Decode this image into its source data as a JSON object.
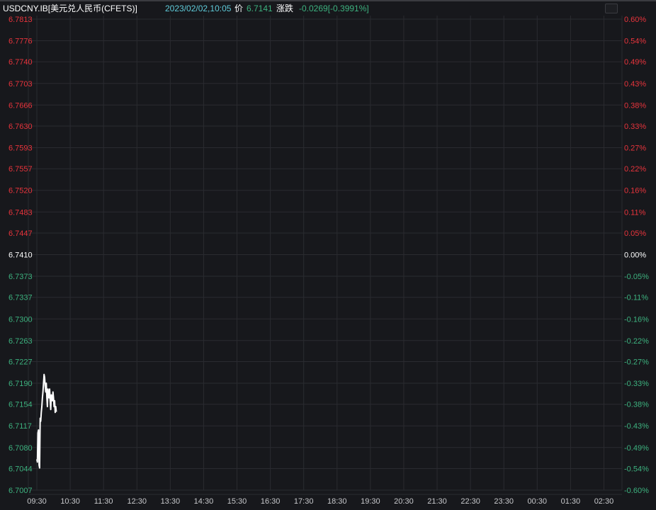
{
  "header": {
    "symbol": "USDCNY.IB[美元兑人民币(CFETS)]",
    "datetime": "2023/02/02,10:05",
    "price_label": "价",
    "price": "6.7141",
    "change_label": "涨跌",
    "change": "-0.0269[-0.3991%]"
  },
  "colors": {
    "background": "#17181c",
    "grid": "#2a2b30",
    "up": "#e8343c",
    "down": "#3db27f",
    "neutral": "#ffffff",
    "cyan": "#5fcbd9",
    "line": "#ffffff"
  },
  "chart_data": {
    "type": "line",
    "y_left_ticks": [
      "6.7813",
      "6.7776",
      "6.7740",
      "6.7703",
      "6.7666",
      "6.7630",
      "6.7593",
      "6.7557",
      "6.7520",
      "6.7483",
      "6.7447",
      "6.7410",
      "6.7373",
      "6.7337",
      "6.7300",
      "6.7263",
      "6.7227",
      "6.7190",
      "6.7154",
      "6.7117",
      "6.7080",
      "6.7044",
      "6.7007"
    ],
    "y_right_ticks": [
      "0.60%",
      "0.54%",
      "0.49%",
      "0.43%",
      "0.38%",
      "0.33%",
      "0.27%",
      "0.22%",
      "0.16%",
      "0.11%",
      "0.05%",
      "0.00%",
      "-0.05%",
      "-0.11%",
      "-0.16%",
      "-0.22%",
      "-0.27%",
      "-0.33%",
      "-0.38%",
      "-0.43%",
      "-0.49%",
      "-0.54%",
      "-0.60%"
    ],
    "x_ticks": [
      "09:30",
      "10:30",
      "11:30",
      "12:30",
      "13:30",
      "14:30",
      "15:30",
      "16:30",
      "17:30",
      "18:30",
      "19:30",
      "20:30",
      "21:30",
      "22:30",
      "23:30",
      "00:30",
      "01:30",
      "02:30"
    ],
    "ylim": [
      6.7007,
      6.7813
    ],
    "prev_close": 6.741,
    "x_start": "09:30",
    "x_end": "03:00",
    "series": [
      {
        "x": [
          "09:30",
          "09:31",
          "09:32",
          "09:33",
          "09:34",
          "09:35",
          "09:36",
          "09:37",
          "09:38",
          "09:39",
          "09:40",
          "09:41",
          "09:42",
          "09:43",
          "09:44",
          "09:45",
          "09:46",
          "09:47",
          "09:48",
          "09:49",
          "09:50",
          "09:51",
          "09:52",
          "09:53",
          "09:54",
          "09:55",
          "09:56",
          "09:57",
          "09:58",
          "09:59",
          "10:00",
          "10:01",
          "10:02",
          "10:03",
          "10:04",
          "10:05"
        ],
        "values": [
          6.706,
          6.7055,
          6.7105,
          6.711,
          6.705,
          6.7045,
          6.713,
          6.7125,
          6.714,
          6.715,
          6.7165,
          6.7175,
          6.719,
          6.7205,
          6.72,
          6.7185,
          6.7175,
          6.719,
          6.7165,
          6.715,
          6.718,
          6.717,
          6.7165,
          6.718,
          6.716,
          6.7145,
          6.717,
          6.7165,
          6.716,
          6.7175,
          6.7165,
          6.715,
          6.716,
          6.714,
          6.715,
          6.7141
        ]
      }
    ]
  }
}
